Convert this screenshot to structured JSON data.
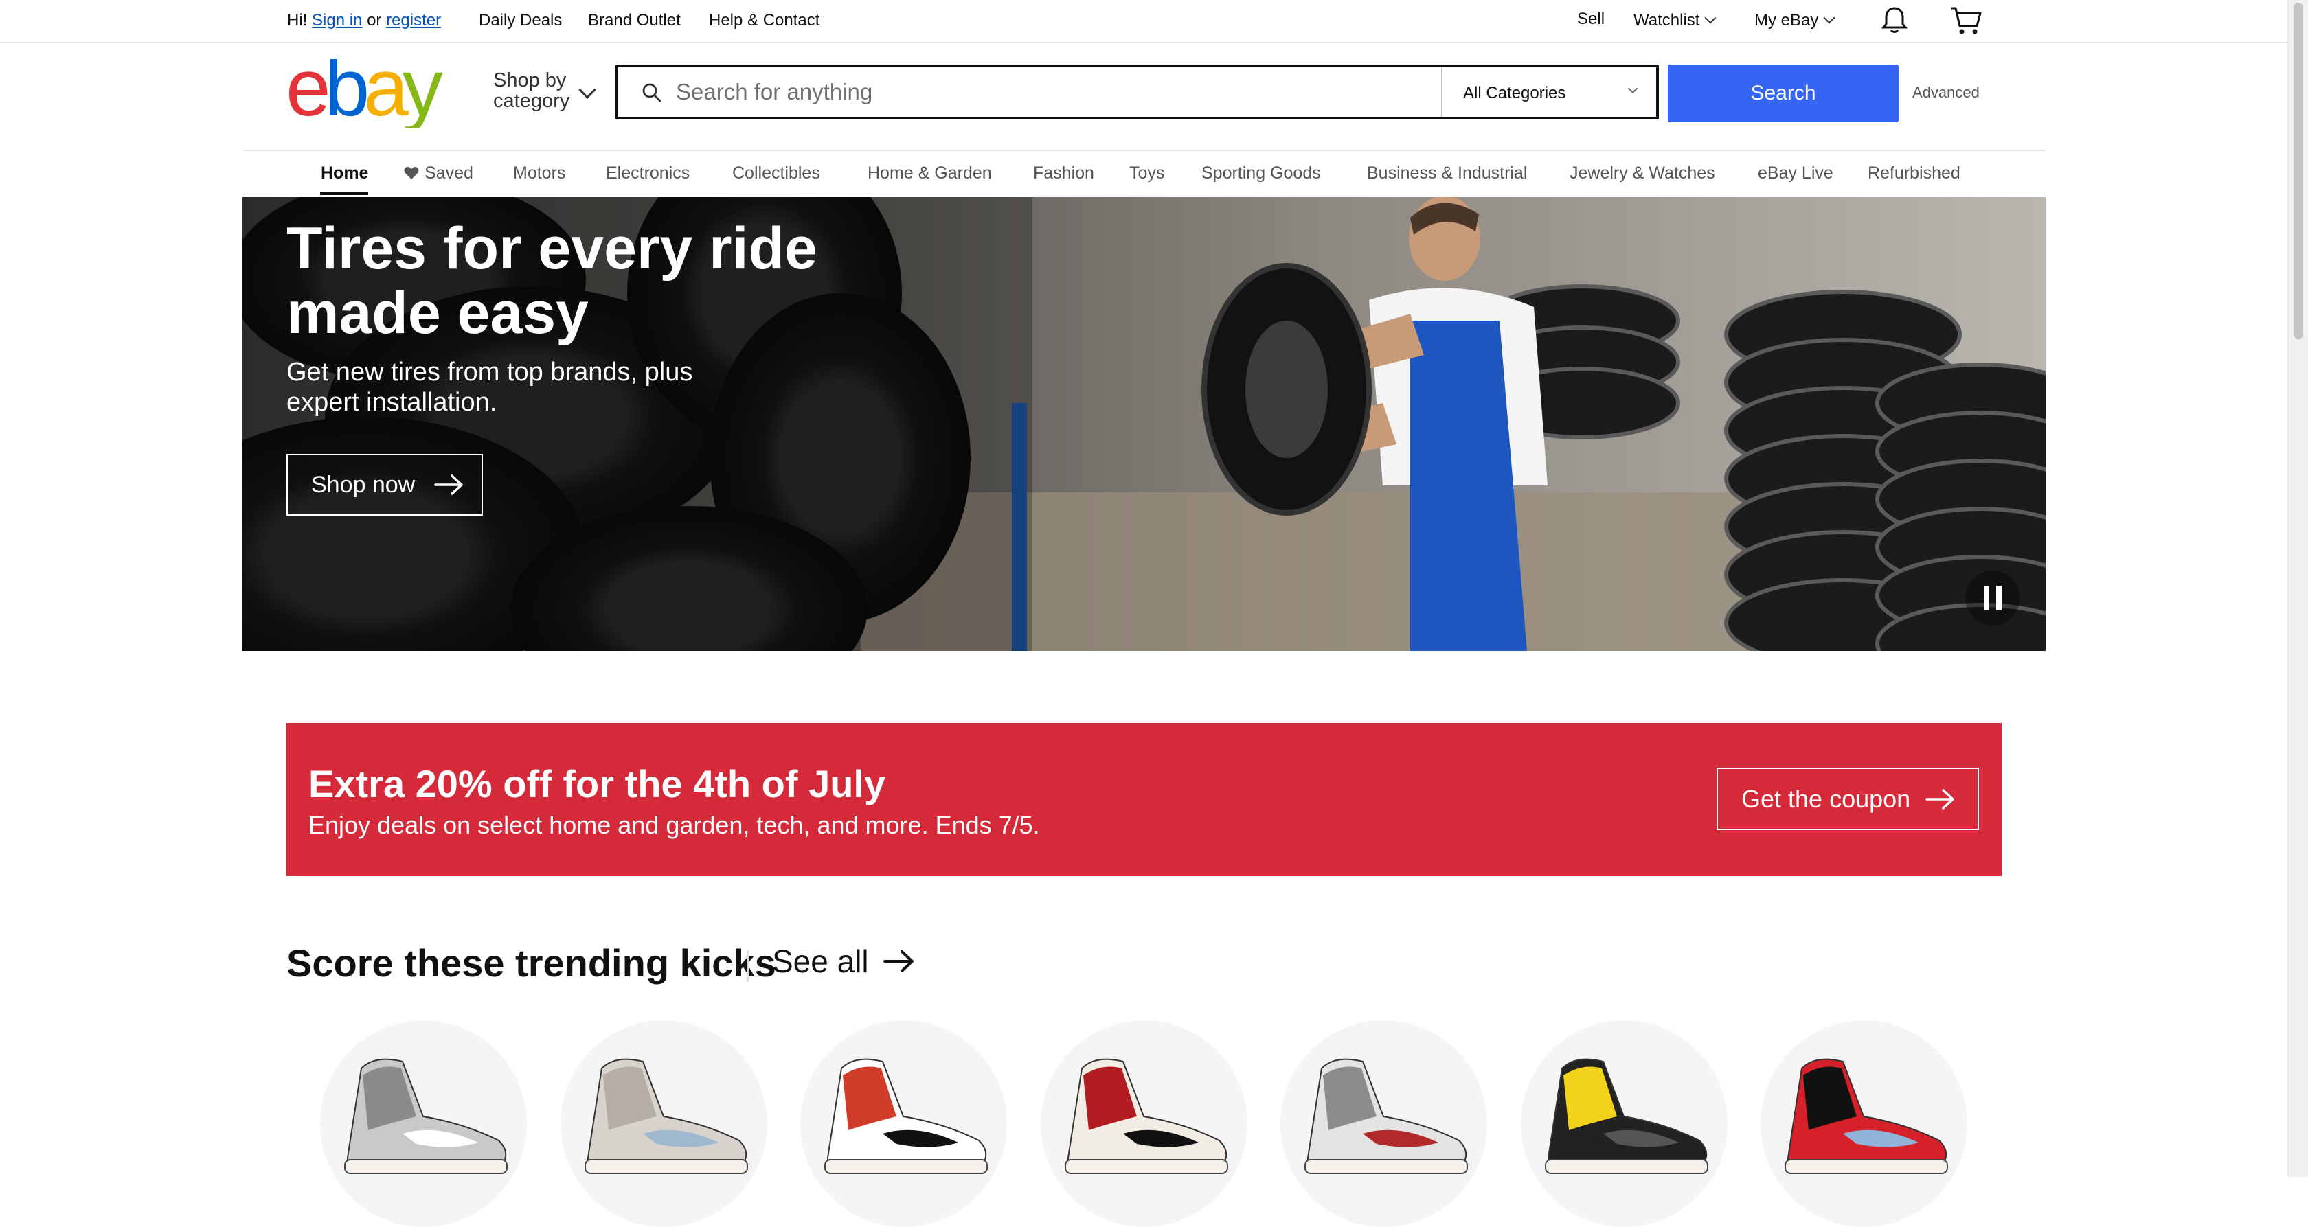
{
  "topbar": {
    "greeting_prefix": "Hi!",
    "sign_in": "Sign in",
    "or": "or",
    "register": "register",
    "daily_deals": "Daily Deals",
    "brand_outlet": "Brand Outlet",
    "help_contact": "Help & Contact",
    "sell": "Sell",
    "watchlist": "Watchlist",
    "my_ebay": "My eBay",
    "notification_icon": "bell-icon",
    "cart_icon": "cart-icon"
  },
  "header": {
    "logo": "ebay",
    "logo_colors": [
      "#e53238",
      "#0064d2",
      "#f5af02",
      "#86b817"
    ],
    "shop_by_line1": "Shop by",
    "shop_by_line2": "category",
    "search_placeholder": "Search for anything",
    "category_selected": "All Categories",
    "search_button": "Search",
    "advanced": "Advanced",
    "accent_color": "#3665f3"
  },
  "nav": {
    "items": [
      "Home",
      "Saved",
      "Motors",
      "Electronics",
      "Collectibles",
      "Home & Garden",
      "Fashion",
      "Toys",
      "Sporting Goods",
      "Business & Industrial",
      "Jewelry & Watches",
      "eBay Live",
      "Refurbished"
    ],
    "active": "Home"
  },
  "hero": {
    "title": "Tires for every ride made easy",
    "subtitle": "Get new tires from top brands, plus expert installation.",
    "cta": "Shop now",
    "pause_icon": "pause-icon"
  },
  "promo": {
    "title": "Extra 20% off for the 4th of July",
    "subtitle": "Enjoy deals on select home and garden, tech, and more. Ends 7/5.",
    "cta": "Get the coupon",
    "background": "#d52a39"
  },
  "trending": {
    "title": "Score these trending kicks",
    "see_all": "See all",
    "items": [
      {
        "name": "sneaker-grey-high",
        "colors": [
          "#c9c9c9",
          "#8a8a8a",
          "#ffffff"
        ]
      },
      {
        "name": "sneaker-tan-retro",
        "colors": [
          "#d8d3cc",
          "#b5aea6",
          "#9fb8d0"
        ]
      },
      {
        "name": "sneaker-red-white-high",
        "colors": [
          "#ffffff",
          "#d23c2a",
          "#111111"
        ]
      },
      {
        "name": "sneaker-red-black-high",
        "colors": [
          "#f1ece4",
          "#b31d22",
          "#111111"
        ]
      },
      {
        "name": "sneaker-cement-grey",
        "colors": [
          "#e3e3e3",
          "#8c8c8c",
          "#b02a2a"
        ]
      },
      {
        "name": "sneaker-black-yellow",
        "colors": [
          "#222222",
          "#f2d21b",
          "#555555"
        ]
      },
      {
        "name": "sneaker-red-suede",
        "colors": [
          "#d6202a",
          "#111111",
          "#8fb4d8"
        ]
      }
    ]
  }
}
